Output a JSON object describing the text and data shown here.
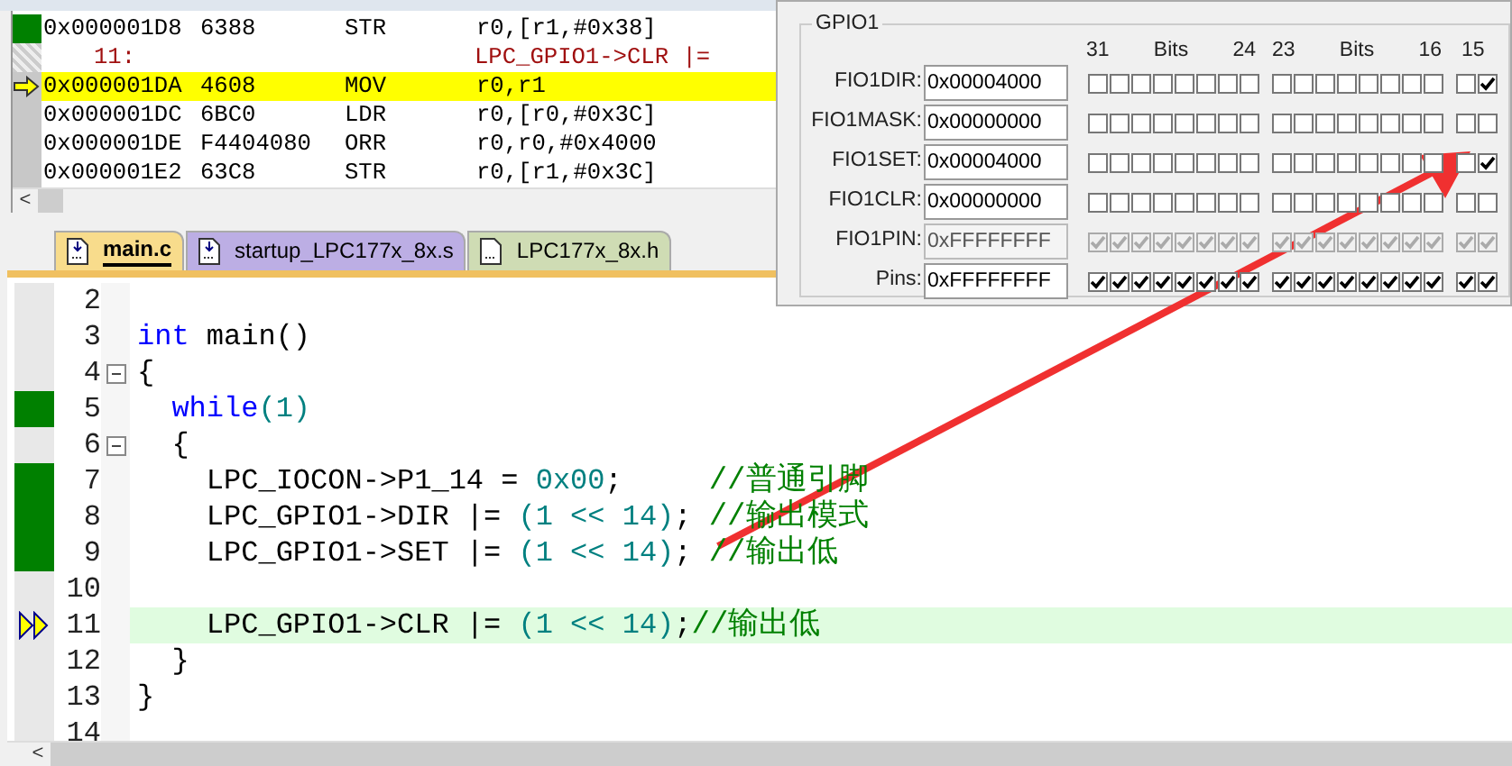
{
  "disassembly": {
    "rows": [
      {
        "kind": "instr",
        "address": "0x000001D8",
        "opcode": "6388",
        "mnemonic": "STR",
        "operands": "r0,[r1,#0x38]",
        "selected": false,
        "executed": true
      },
      {
        "kind": "source",
        "line": "11:",
        "code": "LPC_GPIO1->CLR |=",
        "selected": false,
        "executed": false
      },
      {
        "kind": "instr",
        "address": "0x000001DA",
        "opcode": "4608",
        "mnemonic": "MOV",
        "operands": "r0,r1",
        "selected": true,
        "executed": false
      },
      {
        "kind": "instr",
        "address": "0x000001DC",
        "opcode": "6BC0",
        "mnemonic": "LDR",
        "operands": "r0,[r0,#0x3C]",
        "selected": false,
        "executed": false
      },
      {
        "kind": "instr",
        "address": "0x000001DE",
        "opcode": "F4404080",
        "mnemonic": "ORR",
        "operands": "r0,r0,#0x4000",
        "selected": false,
        "executed": false
      },
      {
        "kind": "instr",
        "address": "0x000001E2",
        "opcode": "63C8",
        "mnemonic": "STR",
        "operands": "r0,[r1,#0x3C]",
        "selected": false,
        "executed": false
      }
    ],
    "scroll_button": "<"
  },
  "tabs": [
    {
      "label": "main.c",
      "selected": true,
      "color": "#f8dc8c"
    },
    {
      "label": "startup_LPC177x_8x.s",
      "selected": false,
      "color": "#bcaee4"
    },
    {
      "label": "LPC177x_8x.h",
      "selected": false,
      "color": "#cfdcb4"
    }
  ],
  "gpio": {
    "group": "GPIO1",
    "bit_headers": [
      "31",
      "Bits",
      "24",
      "23",
      "Bits",
      "16",
      "15"
    ],
    "registers": [
      {
        "name": "FIO1DIR:",
        "value": "0x00004000",
        "disabled": false,
        "bits": [
          false,
          false,
          false,
          false,
          false,
          false,
          false,
          false,
          false,
          false,
          false,
          false,
          false,
          false,
          false,
          false,
          false,
          true
        ]
      },
      {
        "name": "FIO1MASK:",
        "value": "0x00000000",
        "disabled": false,
        "bits": [
          false,
          false,
          false,
          false,
          false,
          false,
          false,
          false,
          false,
          false,
          false,
          false,
          false,
          false,
          false,
          false,
          false,
          false
        ]
      },
      {
        "name": "FIO1SET:",
        "value": "0x00004000",
        "disabled": false,
        "bits": [
          false,
          false,
          false,
          false,
          false,
          false,
          false,
          false,
          false,
          false,
          false,
          false,
          false,
          false,
          false,
          false,
          false,
          true
        ]
      },
      {
        "name": "FIO1CLR:",
        "value": "0x00000000",
        "disabled": false,
        "bits": [
          false,
          false,
          false,
          false,
          false,
          false,
          false,
          false,
          false,
          false,
          false,
          false,
          false,
          false,
          false,
          false,
          false,
          false
        ]
      },
      {
        "name": "FIO1PIN:",
        "value": "0xFFFFFFFF",
        "disabled": true,
        "bits": [
          true,
          true,
          true,
          true,
          true,
          true,
          true,
          true,
          true,
          true,
          true,
          true,
          true,
          true,
          true,
          true,
          true,
          true
        ]
      },
      {
        "name": "Pins:",
        "value": "0xFFFFFFFF",
        "disabled": false,
        "bits": [
          true,
          true,
          true,
          true,
          true,
          true,
          true,
          true,
          true,
          true,
          true,
          true,
          true,
          true,
          true,
          true,
          true,
          true
        ]
      }
    ]
  },
  "editor": {
    "lines": [
      {
        "number": "2",
        "executed": false,
        "fold": false,
        "current": false
      },
      {
        "number": "3",
        "executed": false,
        "fold": false,
        "current": false,
        "tokens": [
          {
            "kind": "keyword",
            "text": "int"
          },
          {
            "kind": "plain",
            "text": " main()"
          }
        ]
      },
      {
        "number": "4",
        "executed": false,
        "fold": true,
        "current": false,
        "tokens": [
          {
            "kind": "plain",
            "text": "{"
          }
        ]
      },
      {
        "number": "5",
        "executed": true,
        "fold": false,
        "current": false,
        "tokens": [
          {
            "kind": "keyword",
            "text": "  while"
          },
          {
            "kind": "number",
            "text": "(1)"
          }
        ]
      },
      {
        "number": "6",
        "executed": false,
        "fold": true,
        "current": false,
        "tokens": [
          {
            "kind": "plain",
            "text": "  {"
          }
        ]
      },
      {
        "number": "7",
        "executed": true,
        "fold": false,
        "current": false,
        "tokens": [
          {
            "kind": "plain",
            "text": "    LPC_IOCON->P1_14 = "
          },
          {
            "kind": "number",
            "text": "0x00"
          },
          {
            "kind": "plain",
            "text": ";     "
          },
          {
            "kind": "comment",
            "text": "//普通引脚"
          }
        ]
      },
      {
        "number": "8",
        "executed": true,
        "fold": false,
        "current": false,
        "tokens": [
          {
            "kind": "plain",
            "text": "    LPC_GPIO1->DIR |= "
          },
          {
            "kind": "number",
            "text": "(1 << 14)"
          },
          {
            "kind": "plain",
            "text": "; "
          },
          {
            "kind": "comment",
            "text": "//输出模式"
          }
        ]
      },
      {
        "number": "9",
        "executed": true,
        "fold": false,
        "current": false,
        "tokens": [
          {
            "kind": "plain",
            "text": "    LPC_GPIO1->SET |= "
          },
          {
            "kind": "number",
            "text": "(1 << 14)"
          },
          {
            "kind": "plain",
            "text": "; "
          },
          {
            "kind": "comment",
            "text": "//输出低"
          }
        ]
      },
      {
        "number": "10",
        "executed": false,
        "fold": false,
        "current": false
      },
      {
        "number": "11",
        "executed": false,
        "fold": false,
        "current": true,
        "tokens": [
          {
            "kind": "plain",
            "text": "    LPC_GPIO1->CLR |= "
          },
          {
            "kind": "number",
            "text": "(1 << 14)"
          },
          {
            "kind": "plain",
            "text": ";"
          },
          {
            "kind": "comment",
            "text": "//输出低"
          }
        ]
      },
      {
        "number": "12",
        "executed": false,
        "fold": false,
        "current": false,
        "tokens": [
          {
            "kind": "plain",
            "text": "  }"
          }
        ]
      },
      {
        "number": "13",
        "executed": false,
        "fold": false,
        "current": false,
        "tokens": [
          {
            "kind": "plain",
            "text": "}"
          }
        ]
      },
      {
        "number": "14",
        "executed": false,
        "fold": false,
        "current": false
      }
    ],
    "scroll_button": "<"
  }
}
